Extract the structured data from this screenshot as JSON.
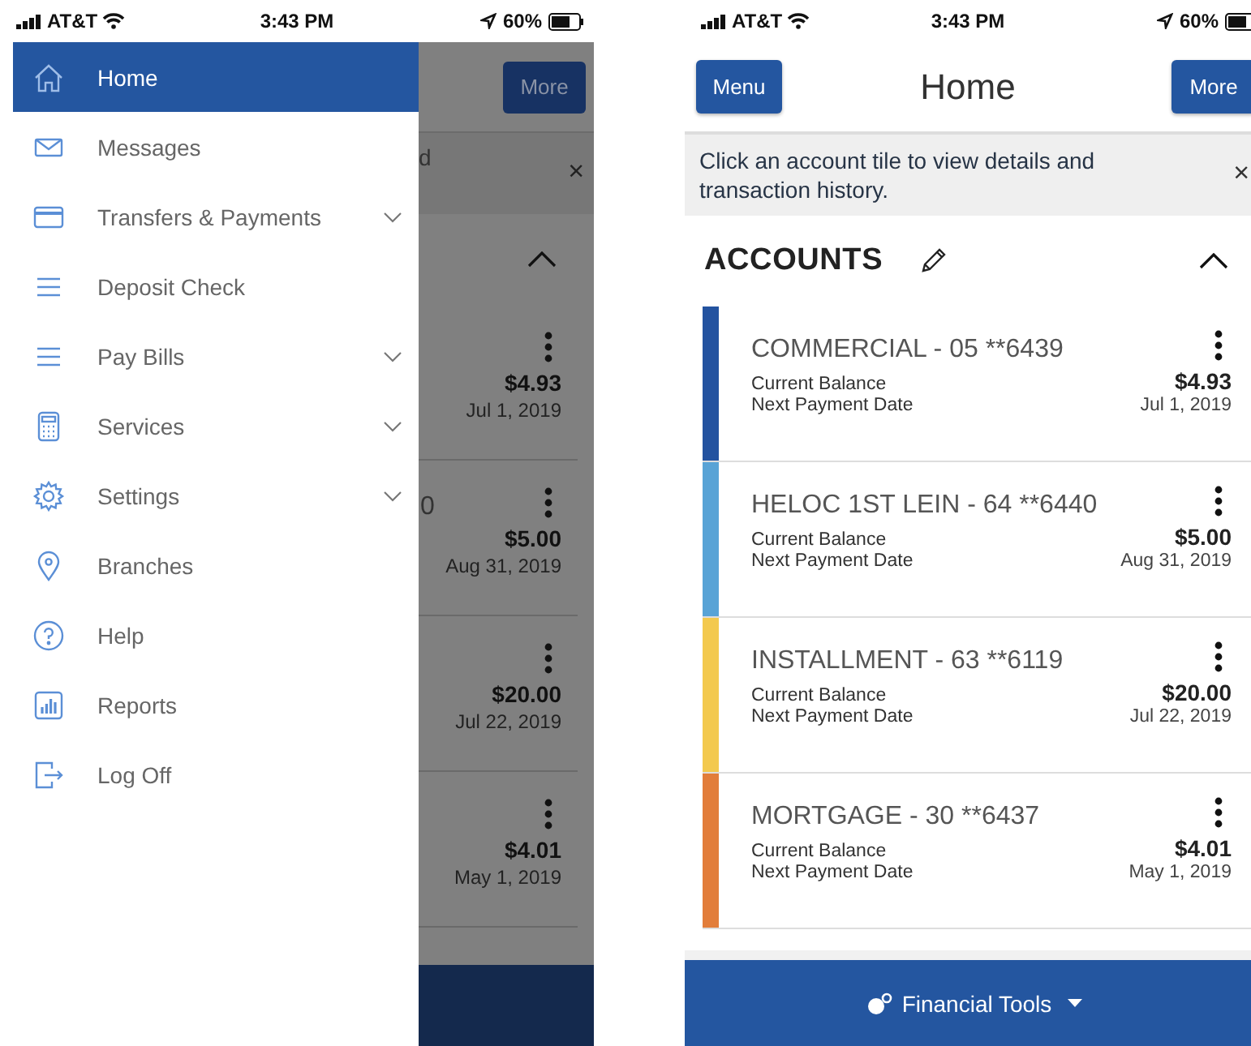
{
  "left_screen": {
    "status_bar": {
      "carrier": "AT&T",
      "time": "3:43 PM",
      "battery": "60%"
    },
    "menu": {
      "items": [
        {
          "label": "Home",
          "kind": "home",
          "expandable": false,
          "selected": true
        },
        {
          "label": "Messages",
          "kind": "mail",
          "expandable": false,
          "selected": false
        },
        {
          "label": "Transfers & Payments",
          "kind": "card",
          "expandable": true,
          "selected": false
        },
        {
          "label": "Deposit Check",
          "kind": "lines",
          "expandable": false,
          "selected": false
        },
        {
          "label": "Pay Bills",
          "kind": "lines",
          "expandable": true,
          "selected": false
        },
        {
          "label": "Services",
          "kind": "calculator",
          "expandable": true,
          "selected": false
        },
        {
          "label": "Settings",
          "kind": "gear",
          "expandable": true,
          "selected": false
        },
        {
          "label": "Branches",
          "kind": "pin",
          "expandable": false,
          "selected": false
        },
        {
          "label": "Help",
          "kind": "help",
          "expandable": false,
          "selected": false
        },
        {
          "label": "Reports",
          "kind": "chart",
          "expandable": false,
          "selected": false
        },
        {
          "label": "Log Off",
          "kind": "logout",
          "expandable": false,
          "selected": false
        }
      ]
    },
    "background": {
      "more_button": "More",
      "banner_fragment": "d",
      "banner_close": "×",
      "expanded": true,
      "tiles": [
        {
          "amount": "$4.93",
          "date": "Jul 1, 2019"
        },
        {
          "name_fragment": "0",
          "amount": "$5.00",
          "date": "Aug 31, 2019"
        },
        {
          "amount": "$20.00",
          "date": "Jul 22, 2019"
        },
        {
          "amount": "$4.01",
          "date": "May 1, 2019"
        }
      ]
    }
  },
  "right_screen": {
    "status_bar": {
      "carrier": "AT&T",
      "time": "3:43 PM",
      "battery": "60%"
    },
    "menu_button": "Menu",
    "title": "Home",
    "more_button": "More",
    "banner": {
      "text": "Click an account tile to view details and transaction history.",
      "close": "×"
    },
    "accounts": {
      "title": "ACCOUNTS",
      "expanded": true,
      "tiles": [
        {
          "name": "COMMERCIAL - 05 **6439",
          "color": "#2353a0",
          "balance_label": "Current Balance",
          "balance": "$4.93",
          "date_label": "Next Payment Date",
          "date": "Jul 1, 2019"
        },
        {
          "name": "HELOC 1ST LEIN - 64 **6440",
          "color": "#58a3d6",
          "balance_label": "Current Balance",
          "balance": "$5.00",
          "date_label": "Next Payment Date",
          "date": "Aug 31, 2019"
        },
        {
          "name": "INSTALLMENT - 63 **6119",
          "color": "#f3c94e",
          "balance_label": "Current Balance",
          "balance": "$20.00",
          "date_label": "Next Payment Date",
          "date": "Jul 22, 2019"
        },
        {
          "name": "MORTGAGE - 30 **6437",
          "color": "#e27d3a",
          "balance_label": "Current Balance",
          "balance": "$4.01",
          "date_label": "Next Payment Date",
          "date": "May 1, 2019"
        }
      ]
    },
    "footer": {
      "label": "Financial Tools"
    }
  }
}
